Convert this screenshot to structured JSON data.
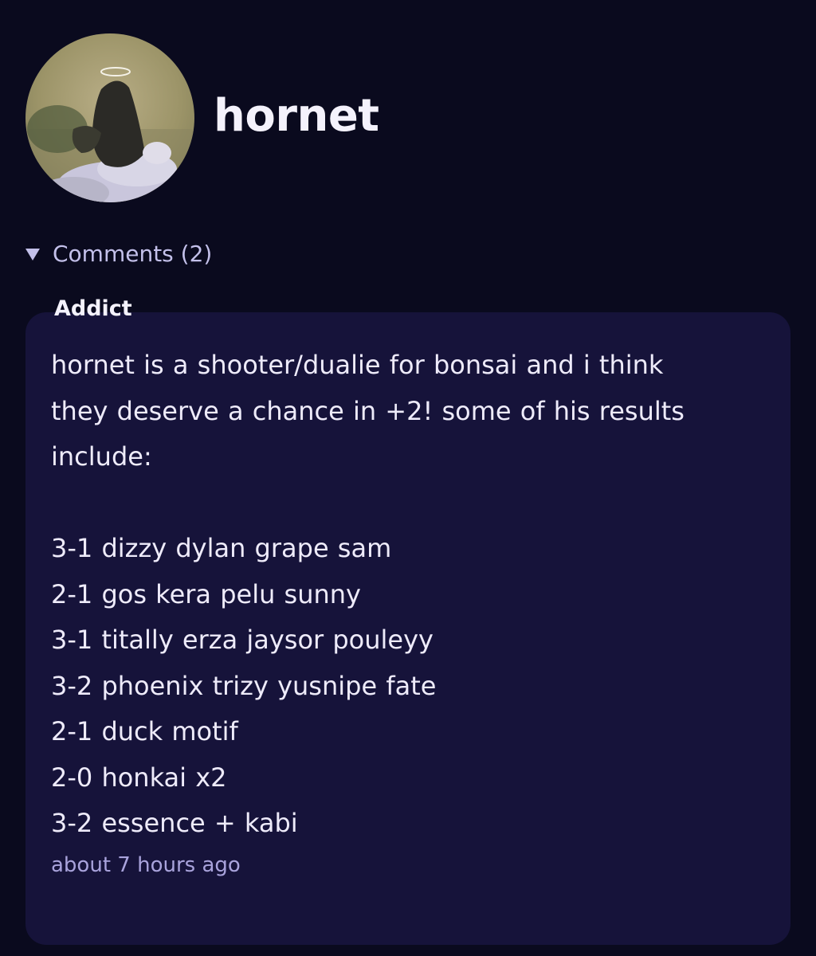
{
  "profile": {
    "username": "hornet"
  },
  "comments_section": {
    "toggle_label": "Comments (2)",
    "comments": [
      {
        "author": "Addict",
        "body": "hornet is a shooter/dualie for bonsai and i think\nthey deserve a chance in +2! some of his results\ninclude:\n\n3-1 dizzy dylan grape sam\n2-1 gos kera pelu sunny\n3-1 titally erza jaysor pouleyy\n3-2 phoenix trizy yusnipe fate\n2-1 duck motif\n2-0 honkai x2\n3-2 essence + kabi",
        "timestamp": "about 7 hours ago"
      }
    ]
  },
  "colors": {
    "background": "#0a0a1e",
    "card": "#16133a",
    "accent_text": "#c3c0ea",
    "muted_text": "#a9a3dc"
  }
}
